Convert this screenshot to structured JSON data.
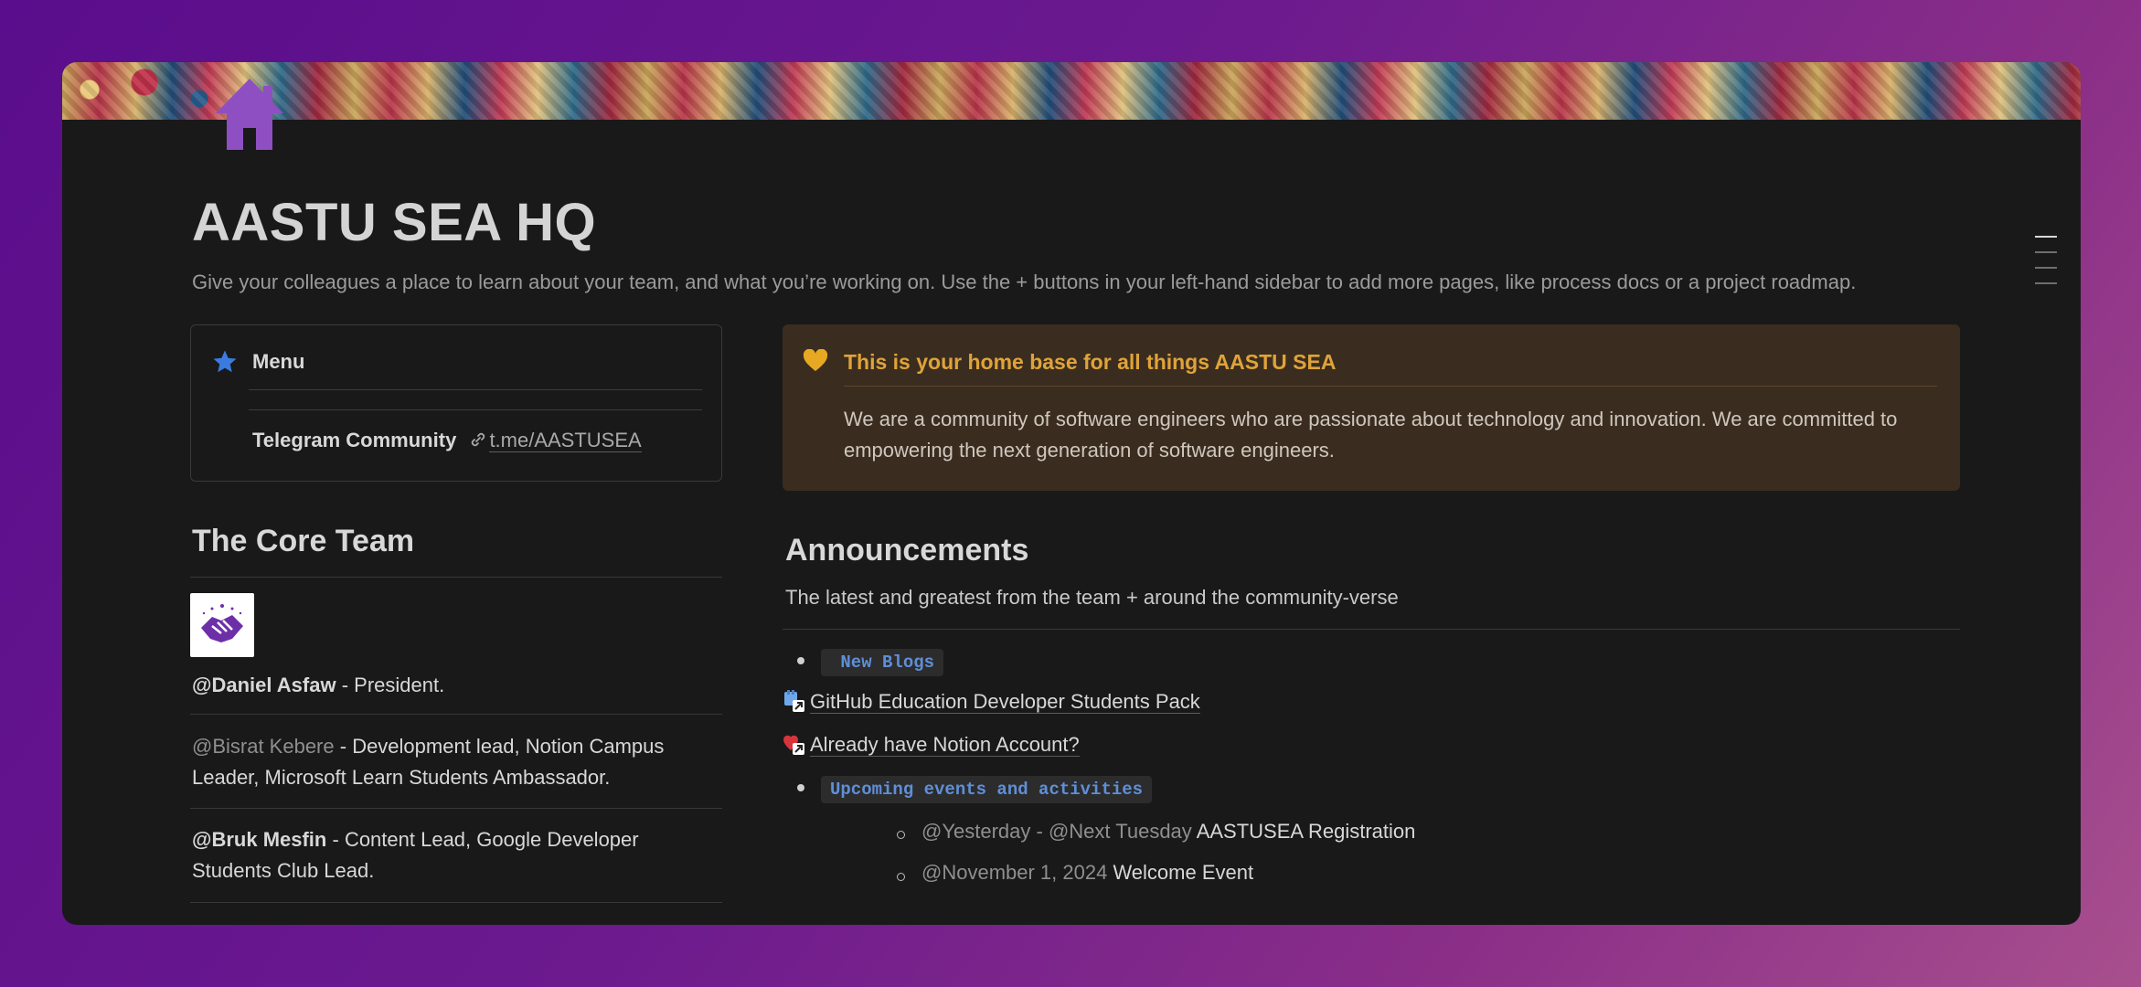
{
  "page": {
    "title": "AASTU SEA HQ",
    "description": "Give your colleagues a place to learn about your team, and what you’re working on. Use the + buttons in your left-hand sidebar to add more pages, like process docs or a project roadmap.",
    "icon": "house-icon",
    "cover": "persian-rug-pattern"
  },
  "menu": {
    "title": "Menu",
    "icon": "star-icon",
    "telegram_label": "Telegram Community",
    "telegram_link": "t.me/AASTUSEA"
  },
  "core_team": {
    "title": "The Core Team",
    "logo": "handshake-logo",
    "members": [
      {
        "mention": "@Daniel Asfaw",
        "sep": " -  ",
        "role": "President."
      },
      {
        "mention": "@Bisrat Kebere",
        "sep": " - ",
        "role": "Development lead, Notion Campus Leader, Microsoft Learn Students Ambassador."
      },
      {
        "mention": "@Bruk Mesfin",
        "sep": " - ",
        "role": "Content Lead, Google Developer Students Club Lead."
      }
    ]
  },
  "callout": {
    "icon": "yellow-heart-icon",
    "title": "This is your home base for all things AASTU SEA",
    "body": "We are a community of software engineers who are passionate about technology and innovation. We are committed to empowering the next generation of software engineers."
  },
  "announcements": {
    "title": "Announcements",
    "subtitle": "The latest and greatest from the team + around the community-verse",
    "new_blogs_tag": " New Blogs",
    "links": [
      {
        "label": "GitHub Education Developer Students Pack",
        "icon": "github-link-icon"
      },
      {
        "label": "Already have Notion Account?",
        "icon": "notion-link-icon"
      }
    ],
    "events_tag": "Upcoming events and activities",
    "events": [
      {
        "date1": "@Yesterday",
        "sep": " - ",
        "date2": "@Next Tuesday",
        "name": " AASTUSEA Registration"
      },
      {
        "date1": "@November 1, 2024",
        "sep": "",
        "date2": "",
        "name": " Welcome Event"
      }
    ]
  },
  "colors": {
    "background_start": "#5a0d8c",
    "background_end": "#a84f8e",
    "window": "#191919",
    "callout_bg": "#3a2d1f",
    "callout_title": "#e0a33a",
    "code_tag": "#5f8fd8"
  }
}
